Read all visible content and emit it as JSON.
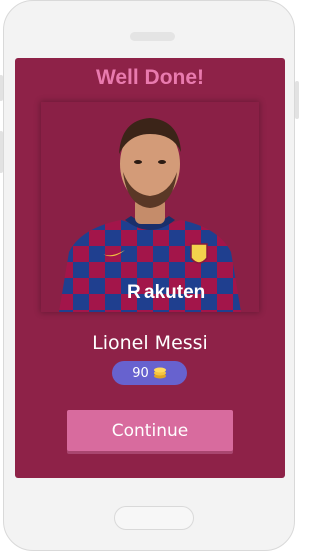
{
  "screen": {
    "title": "Well Done!",
    "player_name": "Lionel Messi",
    "coins": "90",
    "continue_label": "Continue",
    "sponsor_text": "Rakuten"
  },
  "colors": {
    "background": "#8e2248",
    "title": "#e97aae",
    "coin_pill": "#6762cf",
    "button": "#d86b9e",
    "jersey_blue": "#1f3f8f",
    "jersey_red": "#a3154a"
  },
  "icons": {
    "coin": "coin-stack-icon"
  }
}
